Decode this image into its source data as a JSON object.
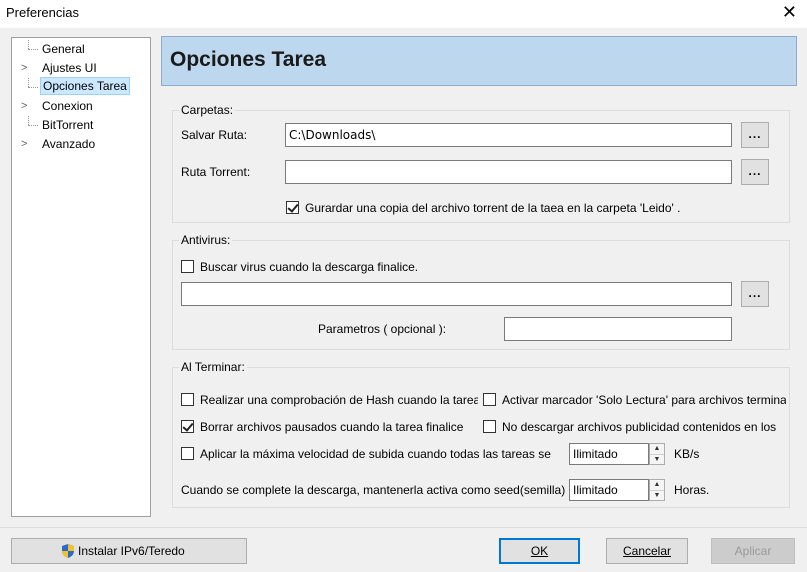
{
  "window": {
    "title": "Preferencias",
    "close_symbol": "✕"
  },
  "tree": {
    "items": [
      {
        "label": "General",
        "expandable": false
      },
      {
        "label": "Ajustes UI",
        "expandable": true
      },
      {
        "label": "Opciones Tarea",
        "expandable": false,
        "selected": true
      },
      {
        "label": "Conexion",
        "expandable": true
      },
      {
        "label": "BitTorrent",
        "expandable": false
      },
      {
        "label": "Avanzado",
        "expandable": true
      }
    ]
  },
  "header": {
    "title": "Opciones Tarea"
  },
  "folders": {
    "title": "Carpetas:",
    "save_path_label": "Salvar Ruta:",
    "save_path_value": "C:\\Downloads\\",
    "torrent_path_label": "Ruta Torrent:",
    "torrent_path_value": "",
    "browse_label": "...",
    "copy_torrent_checkbox": {
      "label": "Gurardar una copia del archivo torrent de la taea en la carpeta 'Leido' .",
      "checked": true
    }
  },
  "antivirus": {
    "title": "Antivirus:",
    "scan_checkbox": {
      "label": "Buscar virus cuando la descarga finalice.",
      "checked": false
    },
    "path_value": "",
    "browse_label": "...",
    "params_label": "Parametros ( opcional ):",
    "params_value": ""
  },
  "on_finish": {
    "title": "Al Terminar:",
    "hash_check": {
      "label": "Realizar una comprobación de Hash cuando la tarea",
      "checked": false
    },
    "readonly_mark": {
      "label": "Activar marcador 'Solo Lectura' para archivos terminados",
      "checked": false
    },
    "delete_paused": {
      "label": "Borrar archivos pausados cuando la tarea finalice",
      "checked": true
    },
    "no_download_ads": {
      "label": "No descargar archivos publicidad contenidos en los",
      "checked": false
    },
    "max_upload": {
      "label": "Aplicar la máxima velocidad de subida cuando todas las tareas se",
      "checked": false
    },
    "upload_value": "Ilimitado",
    "upload_unit": "KB/s",
    "seed_label": "Cuando se complete la descarga, mantenerla activa como seed(semilla)",
    "seed_value": "Ilimitado",
    "seed_unit": "Horas."
  },
  "footer": {
    "ipv6_button": "Instalar IPv6/Teredo",
    "ok_button": "OK",
    "cancel_button": "Cancelar",
    "apply_button": "Aplicar"
  },
  "colors": {
    "header_bg": "#bdd7ee",
    "selection_bg": "#cce8ff",
    "default_button_border": "#0078d7"
  }
}
